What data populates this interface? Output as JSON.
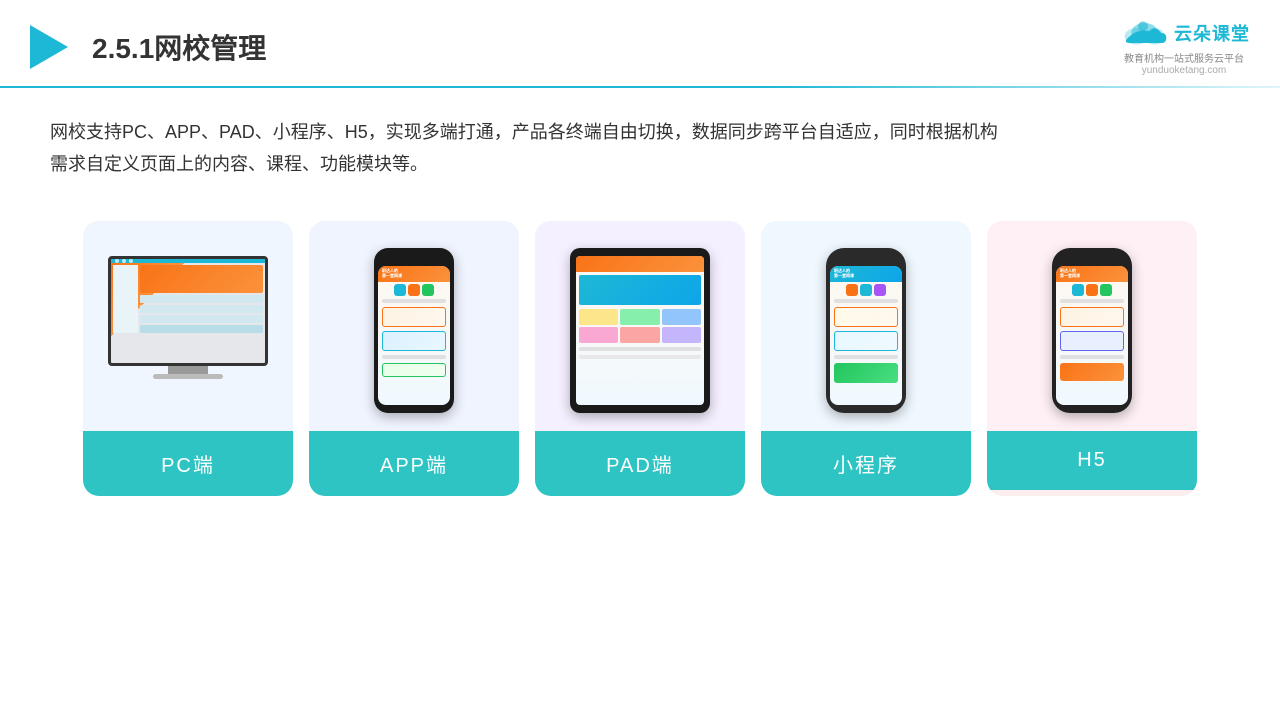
{
  "header": {
    "title": "2.5.1网校管理",
    "title_number": "2.5.1",
    "title_main": "网校管理",
    "logo_name": "云朵课堂",
    "logo_url": "yunduoketang.com",
    "logo_tagline": "教育机构一站\n式服务云平台"
  },
  "description": {
    "text1": "网校支持PC、APP、PAD、小程序、H5，实现多端打通，产品各终端自由切换，数据同步跨平台自适应，同时根据机构",
    "text2": "需求自定义页面上的内容、课程、功能模块等。"
  },
  "cards": [
    {
      "id": "pc",
      "label": "PC端"
    },
    {
      "id": "app",
      "label": "APP端"
    },
    {
      "id": "pad",
      "label": "PAD端"
    },
    {
      "id": "miniprogram",
      "label": "小程序"
    },
    {
      "id": "h5",
      "label": "H5"
    }
  ],
  "colors": {
    "accent": "#1db8d5",
    "card_label_bg": "#2ec4c4",
    "orange": "#f97316"
  }
}
